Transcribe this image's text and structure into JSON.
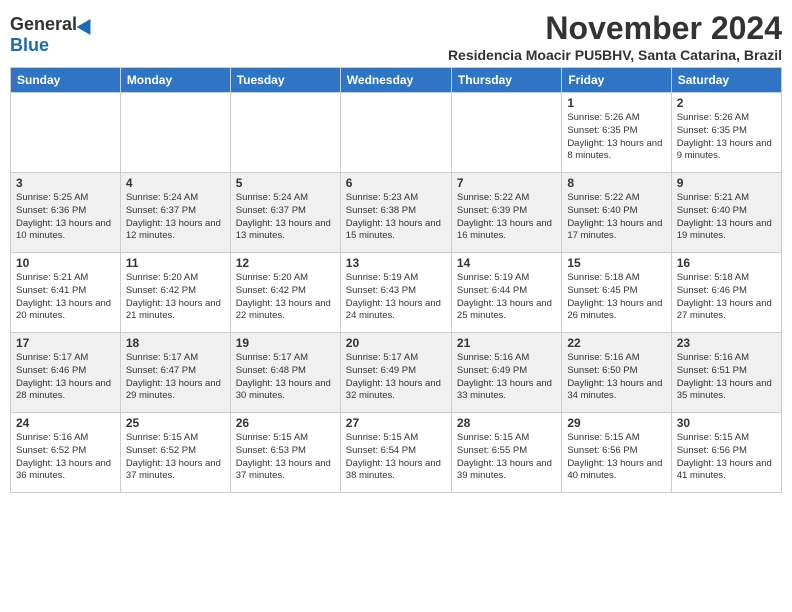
{
  "header": {
    "logo_general": "General",
    "logo_blue": "Blue",
    "month_title": "November 2024",
    "subtitle": "Residencia Moacir PU5BHV, Santa Catarina, Brazil"
  },
  "weekdays": [
    "Sunday",
    "Monday",
    "Tuesday",
    "Wednesday",
    "Thursday",
    "Friday",
    "Saturday"
  ],
  "weeks": [
    [
      {
        "day": "",
        "detail": ""
      },
      {
        "day": "",
        "detail": ""
      },
      {
        "day": "",
        "detail": ""
      },
      {
        "day": "",
        "detail": ""
      },
      {
        "day": "",
        "detail": ""
      },
      {
        "day": "1",
        "detail": "Sunrise: 5:26 AM\nSunset: 6:35 PM\nDaylight: 13 hours and 8 minutes."
      },
      {
        "day": "2",
        "detail": "Sunrise: 5:26 AM\nSunset: 6:35 PM\nDaylight: 13 hours and 9 minutes."
      }
    ],
    [
      {
        "day": "3",
        "detail": "Sunrise: 5:25 AM\nSunset: 6:36 PM\nDaylight: 13 hours and 10 minutes."
      },
      {
        "day": "4",
        "detail": "Sunrise: 5:24 AM\nSunset: 6:37 PM\nDaylight: 13 hours and 12 minutes."
      },
      {
        "day": "5",
        "detail": "Sunrise: 5:24 AM\nSunset: 6:37 PM\nDaylight: 13 hours and 13 minutes."
      },
      {
        "day": "6",
        "detail": "Sunrise: 5:23 AM\nSunset: 6:38 PM\nDaylight: 13 hours and 15 minutes."
      },
      {
        "day": "7",
        "detail": "Sunrise: 5:22 AM\nSunset: 6:39 PM\nDaylight: 13 hours and 16 minutes."
      },
      {
        "day": "8",
        "detail": "Sunrise: 5:22 AM\nSunset: 6:40 PM\nDaylight: 13 hours and 17 minutes."
      },
      {
        "day": "9",
        "detail": "Sunrise: 5:21 AM\nSunset: 6:40 PM\nDaylight: 13 hours and 19 minutes."
      }
    ],
    [
      {
        "day": "10",
        "detail": "Sunrise: 5:21 AM\nSunset: 6:41 PM\nDaylight: 13 hours and 20 minutes."
      },
      {
        "day": "11",
        "detail": "Sunrise: 5:20 AM\nSunset: 6:42 PM\nDaylight: 13 hours and 21 minutes."
      },
      {
        "day": "12",
        "detail": "Sunrise: 5:20 AM\nSunset: 6:42 PM\nDaylight: 13 hours and 22 minutes."
      },
      {
        "day": "13",
        "detail": "Sunrise: 5:19 AM\nSunset: 6:43 PM\nDaylight: 13 hours and 24 minutes."
      },
      {
        "day": "14",
        "detail": "Sunrise: 5:19 AM\nSunset: 6:44 PM\nDaylight: 13 hours and 25 minutes."
      },
      {
        "day": "15",
        "detail": "Sunrise: 5:18 AM\nSunset: 6:45 PM\nDaylight: 13 hours and 26 minutes."
      },
      {
        "day": "16",
        "detail": "Sunrise: 5:18 AM\nSunset: 6:46 PM\nDaylight: 13 hours and 27 minutes."
      }
    ],
    [
      {
        "day": "17",
        "detail": "Sunrise: 5:17 AM\nSunset: 6:46 PM\nDaylight: 13 hours and 28 minutes."
      },
      {
        "day": "18",
        "detail": "Sunrise: 5:17 AM\nSunset: 6:47 PM\nDaylight: 13 hours and 29 minutes."
      },
      {
        "day": "19",
        "detail": "Sunrise: 5:17 AM\nSunset: 6:48 PM\nDaylight: 13 hours and 30 minutes."
      },
      {
        "day": "20",
        "detail": "Sunrise: 5:17 AM\nSunset: 6:49 PM\nDaylight: 13 hours and 32 minutes."
      },
      {
        "day": "21",
        "detail": "Sunrise: 5:16 AM\nSunset: 6:49 PM\nDaylight: 13 hours and 33 minutes."
      },
      {
        "day": "22",
        "detail": "Sunrise: 5:16 AM\nSunset: 6:50 PM\nDaylight: 13 hours and 34 minutes."
      },
      {
        "day": "23",
        "detail": "Sunrise: 5:16 AM\nSunset: 6:51 PM\nDaylight: 13 hours and 35 minutes."
      }
    ],
    [
      {
        "day": "24",
        "detail": "Sunrise: 5:16 AM\nSunset: 6:52 PM\nDaylight: 13 hours and 36 minutes."
      },
      {
        "day": "25",
        "detail": "Sunrise: 5:15 AM\nSunset: 6:52 PM\nDaylight: 13 hours and 37 minutes."
      },
      {
        "day": "26",
        "detail": "Sunrise: 5:15 AM\nSunset: 6:53 PM\nDaylight: 13 hours and 37 minutes."
      },
      {
        "day": "27",
        "detail": "Sunrise: 5:15 AM\nSunset: 6:54 PM\nDaylight: 13 hours and 38 minutes."
      },
      {
        "day": "28",
        "detail": "Sunrise: 5:15 AM\nSunset: 6:55 PM\nDaylight: 13 hours and 39 minutes."
      },
      {
        "day": "29",
        "detail": "Sunrise: 5:15 AM\nSunset: 6:56 PM\nDaylight: 13 hours and 40 minutes."
      },
      {
        "day": "30",
        "detail": "Sunrise: 5:15 AM\nSunset: 6:56 PM\nDaylight: 13 hours and 41 minutes."
      }
    ]
  ]
}
